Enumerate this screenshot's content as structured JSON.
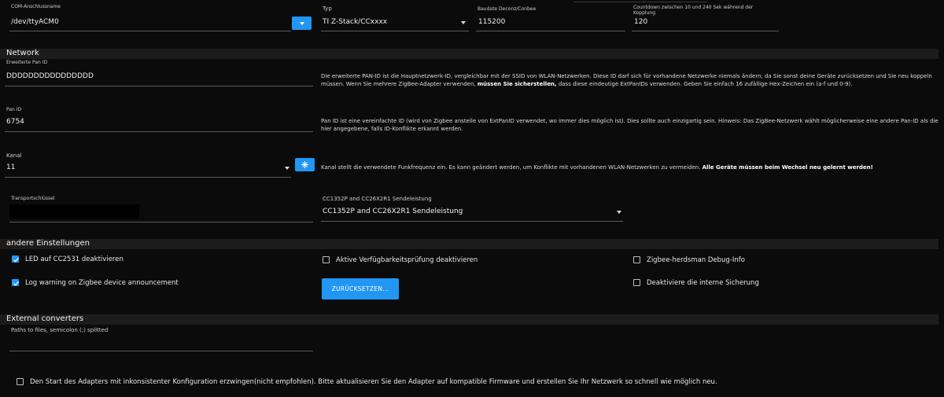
{
  "top": {
    "com_label": "COM-Anschlussname",
    "com_value": "/dev/ttyACM0",
    "typ_label": "Typ",
    "typ_value": "TI Z-Stack/CCxxxx",
    "baud_label": "Baudate Deconz/Conbee",
    "baud_value": "115200",
    "countdown_label_1": "Countdown zwischen 10 und 240 Sek während der",
    "countdown_label_2": "Kopplung",
    "countdown_value": "120"
  },
  "network": {
    "title": "Network",
    "extpan_label": "Erweiterte Pan ID",
    "extpan_value": "DDDDDDDDDDDDDDDD",
    "extpan_desc_1": "Die erweiterte PAN-ID ist die Hauptnetzwerk-ID, vergleichbar mit der SSID von WLAN-Netzwerken. Diese ID darf sich für vorhandene Netzwerke niemals ändern, da Sie sonst deine Geräte zurücksetzen und Sie neu koppeln",
    "extpan_desc_2a": "müssen. Wenn Sie mehrere ZigBee-Adapter verwenden, ",
    "extpan_desc_2b": "müssen Sie sicherstellen,",
    "extpan_desc_2c": " dass diese eindeutige ExtPanIDs verwenden. Geben Sie einfach 16 zufällige Hex-Zeichen ein (a-f und 0-9).",
    "pan_label": "Pan ID",
    "pan_value": "6754",
    "pan_desc_1": "Pan ID ist eine vereinfachte ID (wird von Zigbee anstelle von ExtPanID verwendet, wo immer dies möglich ist). Dies sollte auch einzigartig sein. Hinweis: Das ZigBee-Netzwerk wählt möglicherweise eine andere Pan-ID als die",
    "pan_desc_2": "hier angegebene, falls ID-Konflikte erkannt werden.",
    "kanal_label": "Kanal",
    "kanal_value": "11",
    "kanal_desc_a": "Kanal stellt die verwendete Funkfrequenz ein. Es kann geändert werden, um Konflikte mit vorhandenen WLAN-Netzwerken zu vermeiden. ",
    "kanal_desc_b": "Alle Geräte müssen beim Wechsel neu gelernt werden!",
    "transport_label": "Transportschlüssel",
    "power_label": "CC1352P and CC26X2R1 Sendeleistung",
    "power_value": "CC1352P and CC26X2R1 Sendeleistung"
  },
  "other": {
    "title": "andere Einstellungen",
    "cb1": "LED auf CC2531 deaktivieren",
    "cb2": "Log warning on Zigbee device announcement",
    "cb3": "Aktive Verfügbarkeitsprüfung deaktivieren",
    "cb4": "Zigbee-herdsman Debug-Info",
    "cb5": "Deaktiviere die interne Sicherung",
    "reset_button": "ZURÜCKSETZEN..."
  },
  "external": {
    "title": "External converters",
    "paths_label": "Paths to files, semicolon (;) splitted",
    "force_label": "Den Start des Adapters mit inkonsistenter Konfiguration erzwingen(nicht empfohlen). Bitte aktualisieren Sie den Adapter auf kompatible Firmware und erstellen Sie Ihr Netzwerk so schnell wie möglich neu."
  },
  "colors": {
    "accent": "#2196f3",
    "section_bg": "#1c1c1c",
    "bg": "#0b0b0b"
  },
  "icons": {
    "dropdown": "chevron-down-icon",
    "wand": "sparkle-icon",
    "check": "check-icon"
  }
}
